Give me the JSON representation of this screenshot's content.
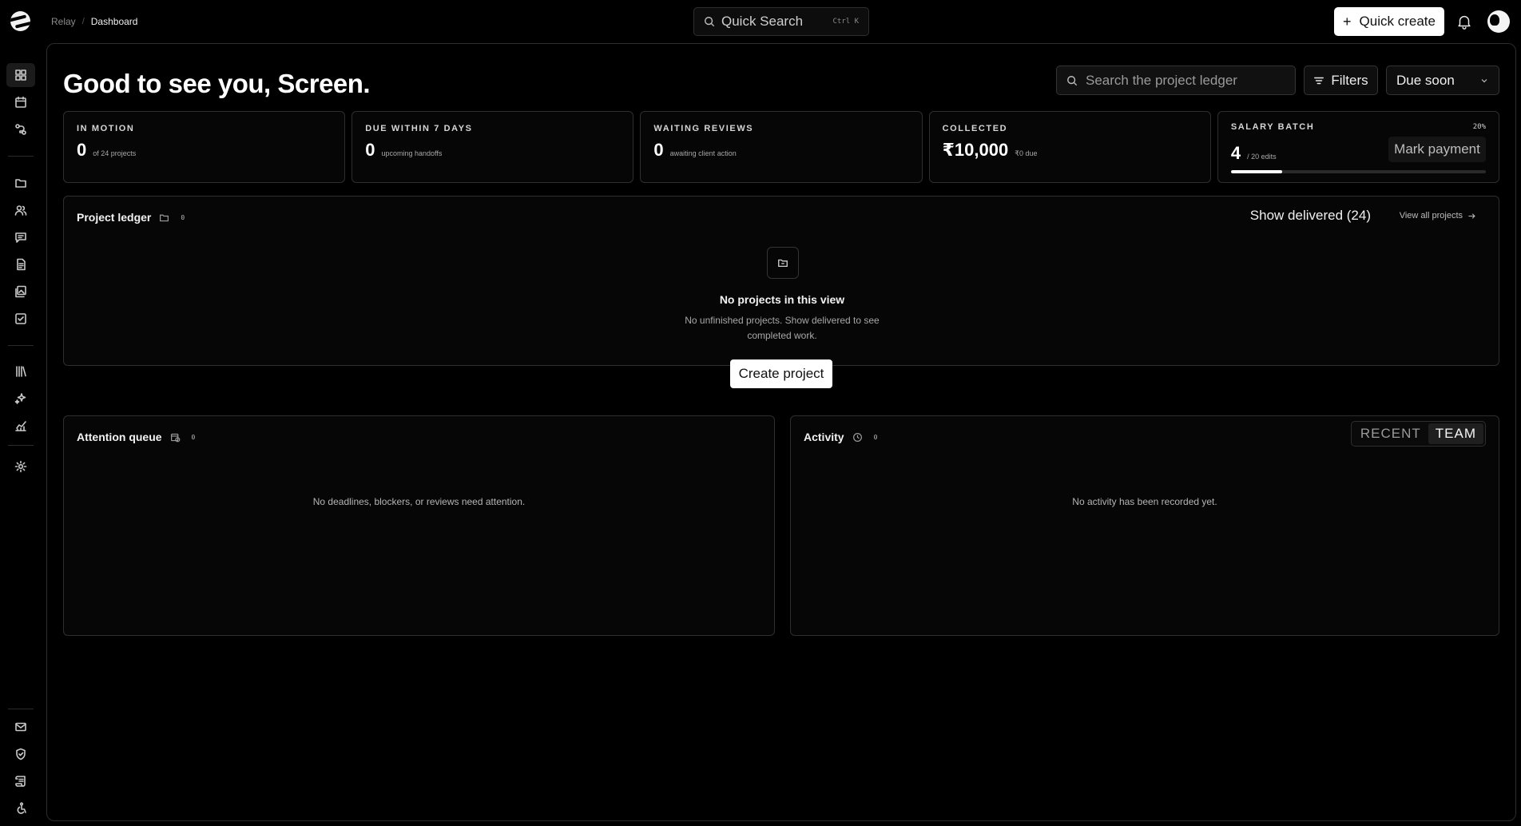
{
  "header": {
    "breadcrumb_root": "Relay",
    "breadcrumb_current": "Dashboard",
    "quick_search_label": "Quick Search",
    "quick_search_shortcut": "Ctrl K",
    "quick_create_label": "Quick create"
  },
  "sidebar": {
    "icons": [
      "dashboard-icon",
      "calendar-icon",
      "workflow-icon",
      "folder-icon",
      "users-icon",
      "messages-icon",
      "document-icon",
      "gallery-icon",
      "checkbox-icon",
      "library-icon",
      "sparkle-icon",
      "analytics-icon",
      "settings-icon",
      "mail-icon",
      "shield-icon",
      "scroll-icon",
      "accessibility-icon"
    ],
    "active": "dashboard-icon"
  },
  "greeting": "Good to see you, Screen.",
  "toolbar": {
    "search_placeholder": "Search the project ledger",
    "filters_label": "Filters",
    "sort_value": "Due soon"
  },
  "stats": {
    "in_motion": {
      "label": "IN MOTION",
      "value": "0",
      "sub": "of 24 projects"
    },
    "due_soon": {
      "label": "DUE WITHIN 7 DAYS",
      "value": "0",
      "sub": "upcoming handoffs"
    },
    "reviews": {
      "label": "WAITING REVIEWS",
      "value": "0",
      "sub": "awaiting client action"
    },
    "collected": {
      "label": "COLLECTED",
      "value": "₹10,000",
      "sub": "₹0 due"
    },
    "salary": {
      "label": "SALARY BATCH",
      "value": "4",
      "sub": "/ 20 edits",
      "percent_text": "20%",
      "progress": 0.2,
      "action_label": "Mark payment"
    }
  },
  "ledger": {
    "title": "Project ledger",
    "count": "0",
    "show_delivered_label": "Show delivered (24)",
    "view_all_label": "View all projects",
    "empty_title": "No projects in this view",
    "empty_desc": "No unfinished projects. Show delivered to see completed work.",
    "create_label": "Create project"
  },
  "attention": {
    "title": "Attention queue",
    "count": "0",
    "empty": "No deadlines, blockers, or reviews need attention."
  },
  "activity": {
    "title": "Activity",
    "count": "0",
    "tab_recent": "RECENT",
    "tab_team": "TEAM",
    "active_tab": "TEAM",
    "empty": "No activity has been recorded yet."
  }
}
